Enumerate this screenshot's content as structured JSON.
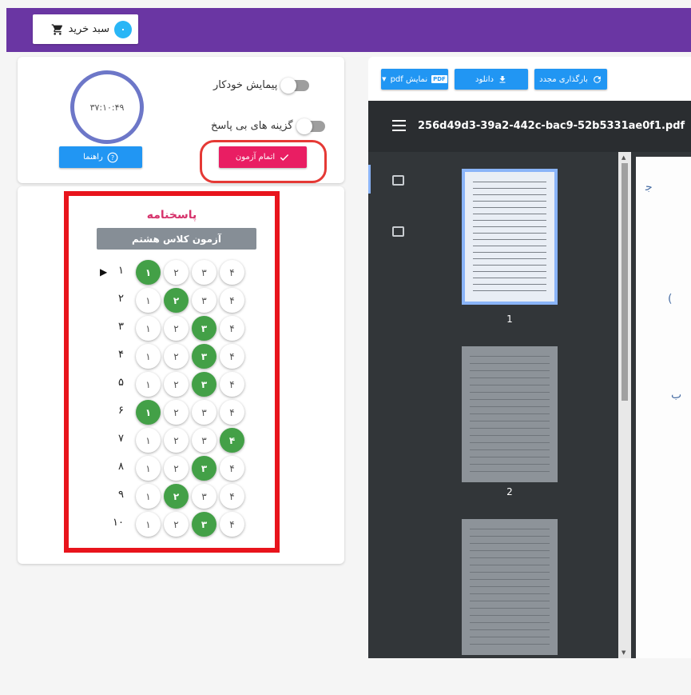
{
  "cart": {
    "label": "سبد خرید",
    "count": "۰",
    "icon": "cart-icon"
  },
  "controls": {
    "timer": "۳۷:۱۰:۴۹",
    "auto_scroll_label": "پیمایش خودکار",
    "unanswered_label": "گزینه های بی پاسخ",
    "help_label": "راهنما",
    "finish_label": "اتمام آزمون"
  },
  "answer_sheet": {
    "title": "پاسخنامه",
    "exam_name": "آزمون کلاس هشتم",
    "option_labels": [
      "۱",
      "۲",
      "۳",
      "۴"
    ],
    "questions": [
      {
        "num": "۱",
        "selected": 1
      },
      {
        "num": "۲",
        "selected": 2
      },
      {
        "num": "۳",
        "selected": 3
      },
      {
        "num": "۴",
        "selected": 3
      },
      {
        "num": "۵",
        "selected": 3
      },
      {
        "num": "۶",
        "selected": 1
      },
      {
        "num": "۷",
        "selected": 4
      },
      {
        "num": "۸",
        "selected": 3
      },
      {
        "num": "۹",
        "selected": 2
      },
      {
        "num": "۱۰",
        "selected": 3
      }
    ],
    "current_question": "۱"
  },
  "toolbar": {
    "reload_label": "بارگذاری مجدد",
    "download_label": "دانلود",
    "show_pdf_label": "نمایش pdf",
    "pdf_badge": "PDF"
  },
  "viewer": {
    "filename": "256d49d3-39a2-442c-bac9-52b5331ae0f1.pdf",
    "pages": [
      "1",
      "2"
    ],
    "current_page": "1"
  },
  "colors": {
    "topbar": "#6a36a3",
    "accent_blue": "#2196f3",
    "finish_pink": "#e91e63",
    "selected_green": "#43a047",
    "highlight_red": "#e8141c"
  }
}
